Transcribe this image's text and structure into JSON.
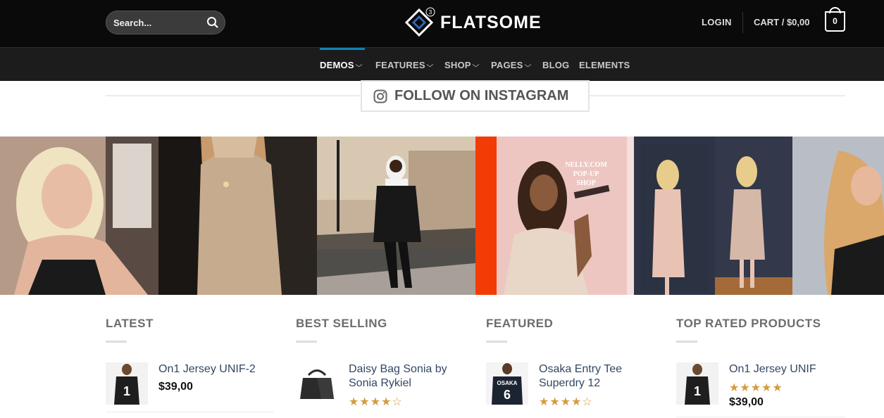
{
  "header": {
    "search": {
      "placeholder": "Search..."
    },
    "logo": {
      "text": "FLATSOME",
      "badge": "3"
    },
    "login_label": "LOGIN",
    "cart_label": "CART / $0,00",
    "cart_count": "0"
  },
  "nav": {
    "items": [
      {
        "label": "DEMOS",
        "dropdown": true,
        "active": true
      },
      {
        "label": "FEATURES",
        "dropdown": true
      },
      {
        "label": "SHOP",
        "dropdown": true
      },
      {
        "label": "PAGES",
        "dropdown": true
      },
      {
        "label": "BLOG",
        "dropdown": false
      },
      {
        "label": "ELEMENTS",
        "dropdown": false
      }
    ]
  },
  "instagram": {
    "title": "FOLLOW ON INSTAGRAM",
    "popup_sign": "NELLY.COM POP-UP SHOP"
  },
  "columns": [
    {
      "title": "LATEST",
      "product": {
        "name": "On1 Jersey UNIF-2",
        "price": "$39,00",
        "thumb": "jersey-1"
      }
    },
    {
      "title": "BEST SELLING",
      "product": {
        "name": "Daisy Bag Sonia by Sonia Rykiel",
        "rating": 4,
        "thumb": "bag"
      }
    },
    {
      "title": "FEATURED",
      "product": {
        "name": "Osaka Entry Tee Superdry 12",
        "rating": 4.5,
        "thumb": "tee-osaka"
      }
    },
    {
      "title": "TOP RATED PRODUCTS",
      "product": {
        "name": "On1 Jersey UNIF",
        "price": "$39,00",
        "rating": 5,
        "thumb": "jersey-1"
      }
    }
  ],
  "colors": {
    "accent": "#0d84b8",
    "star": "#d59b3a",
    "link": "#334862"
  }
}
